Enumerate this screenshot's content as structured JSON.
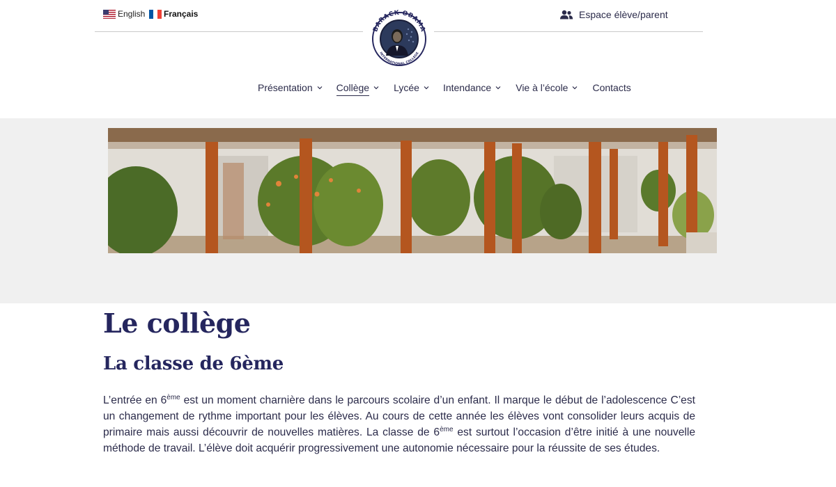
{
  "header": {
    "languages": [
      {
        "label": "English",
        "flag": "us-flag-icon"
      },
      {
        "label": "Français",
        "flag": "fr-flag-icon",
        "active": true
      }
    ],
    "account_link": {
      "label": "Espace élève/parent",
      "icon": "users-icon"
    },
    "logo": {
      "top_text": "BARACK OBAMA",
      "bottom_text": "INTERNATIONAL COLLEGE"
    }
  },
  "nav": {
    "items": [
      {
        "label": "Présentation",
        "has_dropdown": true
      },
      {
        "label": "Collège",
        "has_dropdown": true,
        "active": true
      },
      {
        "label": "Lycée",
        "has_dropdown": true
      },
      {
        "label": "Intendance",
        "has_dropdown": true
      },
      {
        "label": "Vie à l’école",
        "has_dropdown": true
      },
      {
        "label": "Contacts",
        "has_dropdown": false
      }
    ]
  },
  "page": {
    "title": "Le collège",
    "subtitle": "La classe de 6ème",
    "paragraph": {
      "p1": "L’entrée en 6",
      "sup1": "ème",
      "p2": " est un moment charnière dans le parcours scolaire d’un enfant. Il marque le début de l’adolescence C’est un changement de rythme important pour les élèves. Au cours de cette année les élèves vont consolider leurs acquis de primaire mais aussi découvrir de nouvelles matières. La classe de 6",
      "sup2": "ème",
      "p3": " est surtout l’occasion d’être initié à une nouvelle méthode de travail. L’élève doit acquérir progressivement une autonomie nécessaire pour la réussite de ses études."
    }
  },
  "colors": {
    "heading": "#25265e",
    "text": "#2b2b4a",
    "banner_bg": "#f0f0f0"
  }
}
